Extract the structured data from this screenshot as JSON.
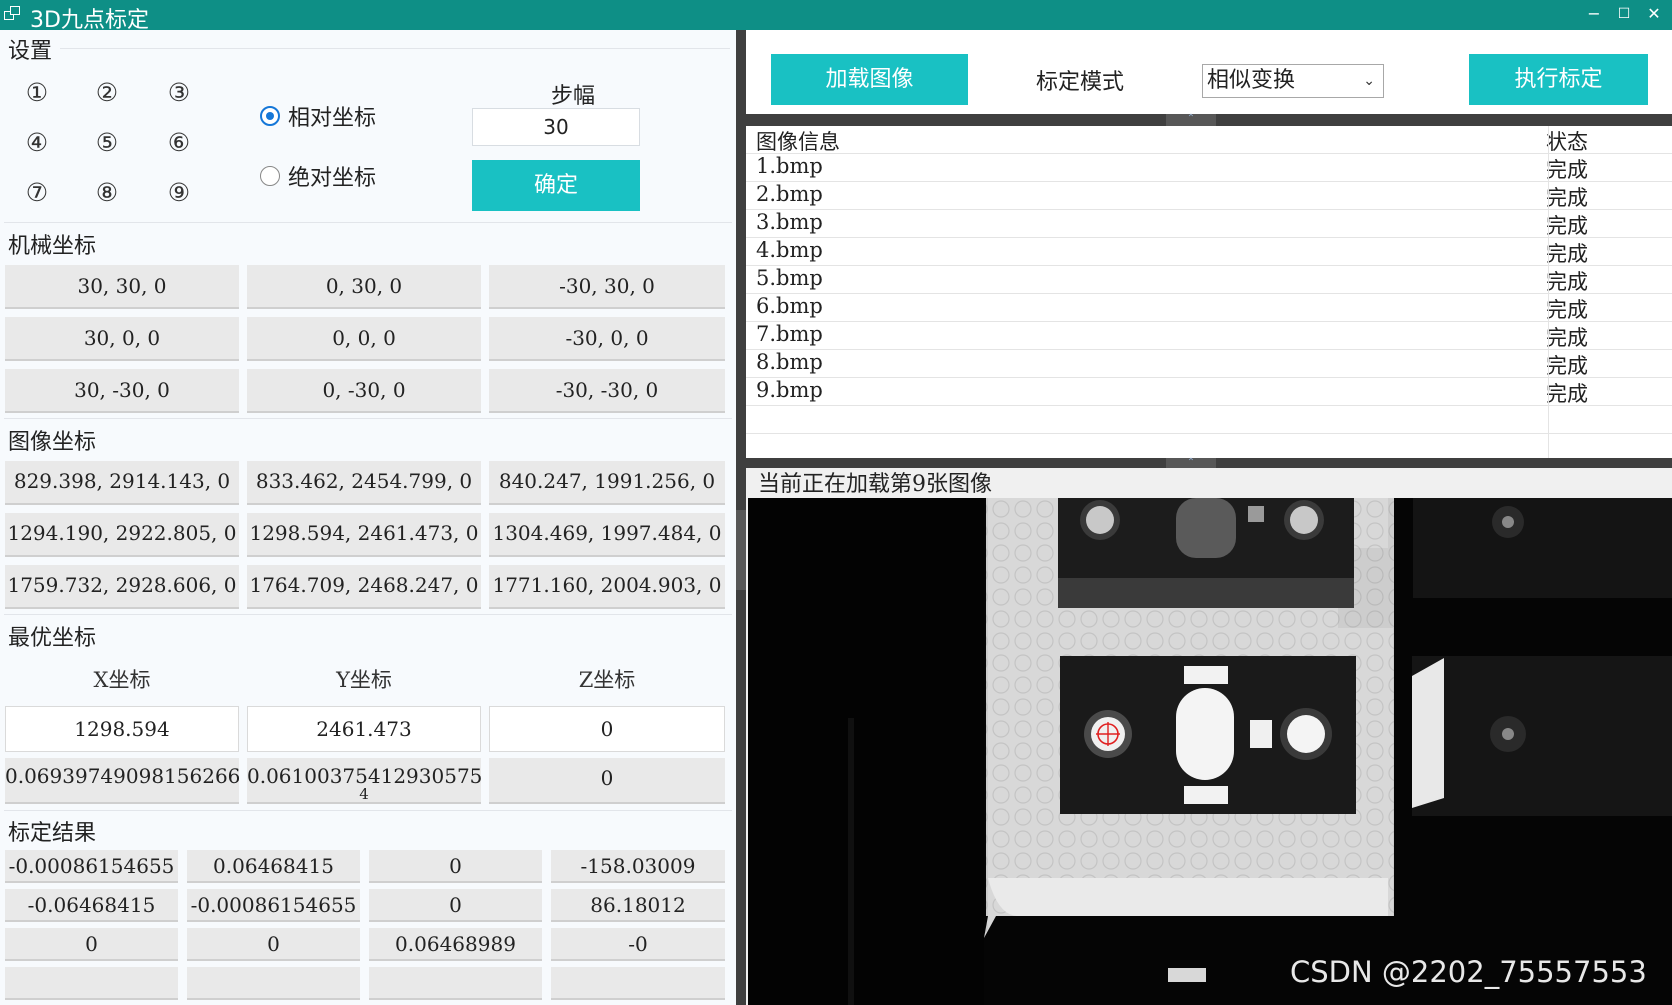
{
  "window": {
    "title": "3D九点标定",
    "minimize": "−",
    "maximize": "☐",
    "close": "✕"
  },
  "settings": {
    "label": "设置",
    "points": [
      "①",
      "②",
      "③",
      "④",
      "⑤",
      "⑥",
      "⑦",
      "⑧",
      "⑨"
    ],
    "relative_label": "相对坐标",
    "absolute_label": "绝对坐标",
    "selected_mode": "relative",
    "step_label": "步幅",
    "step_value": "30",
    "confirm_label": "确定"
  },
  "machine": {
    "label": "机械坐标",
    "cells": [
      "30, 30, 0",
      "0, 30, 0",
      "-30, 30, 0",
      "30, 0, 0",
      "0, 0, 0",
      "-30, 0, 0",
      "30, -30, 0",
      "0, -30, 0",
      "-30, -30, 0"
    ]
  },
  "image_coords": {
    "label": "图像坐标",
    "cells": [
      "829.398, 2914.143, 0",
      "833.462, 2454.799, 0",
      "840.247, 1991.256, 0",
      "1294.190, 2922.805, 0",
      "1298.594, 2461.473, 0",
      "1304.469, 1997.484, 0",
      "1759.732, 2928.606, 0",
      "1764.709, 2468.247, 0",
      "1771.160, 2004.903, 0"
    ]
  },
  "optimal": {
    "label": "最优坐标",
    "headers": [
      "X坐标",
      "Y坐标",
      "Z坐标"
    ],
    "values": [
      "1298.594",
      "2461.473",
      "0"
    ],
    "errors": [
      "0.06939749098156266",
      "0.06100375412930575",
      "0"
    ],
    "error_overflow": "4"
  },
  "calibration": {
    "label": "标定结果",
    "rows": [
      [
        "-0.00086154655",
        "0.06468415",
        "0",
        "-158.03009"
      ],
      [
        "-0.06468415",
        "-0.00086154655",
        "0",
        "86.18012"
      ],
      [
        "0",
        "0",
        "0.06468989",
        "-0"
      ],
      [
        "",
        "",
        "",
        ""
      ]
    ]
  },
  "toolbar": {
    "load_label": "加载图像",
    "mode_label": "标定模式",
    "mode_value": "相似变换",
    "run_label": "执行标定"
  },
  "image_table": {
    "headers": [
      "图像信息",
      "状态"
    ],
    "rows": [
      [
        "1.bmp",
        "完成"
      ],
      [
        "2.bmp",
        "完成"
      ],
      [
        "3.bmp",
        "完成"
      ],
      [
        "4.bmp",
        "完成"
      ],
      [
        "5.bmp",
        "完成"
      ],
      [
        "6.bmp",
        "完成"
      ],
      [
        "7.bmp",
        "完成"
      ],
      [
        "8.bmp",
        "完成"
      ],
      [
        "9.bmp",
        "完成"
      ]
    ]
  },
  "status": {
    "loading_text": "当前正在加载第9张图像"
  },
  "watermark": "CSDN @2202_75557553",
  "colors": {
    "titlebar": "#0e8f86",
    "accent": "#19c1c3",
    "radio": "#1577d8",
    "marker": "#e02020"
  }
}
